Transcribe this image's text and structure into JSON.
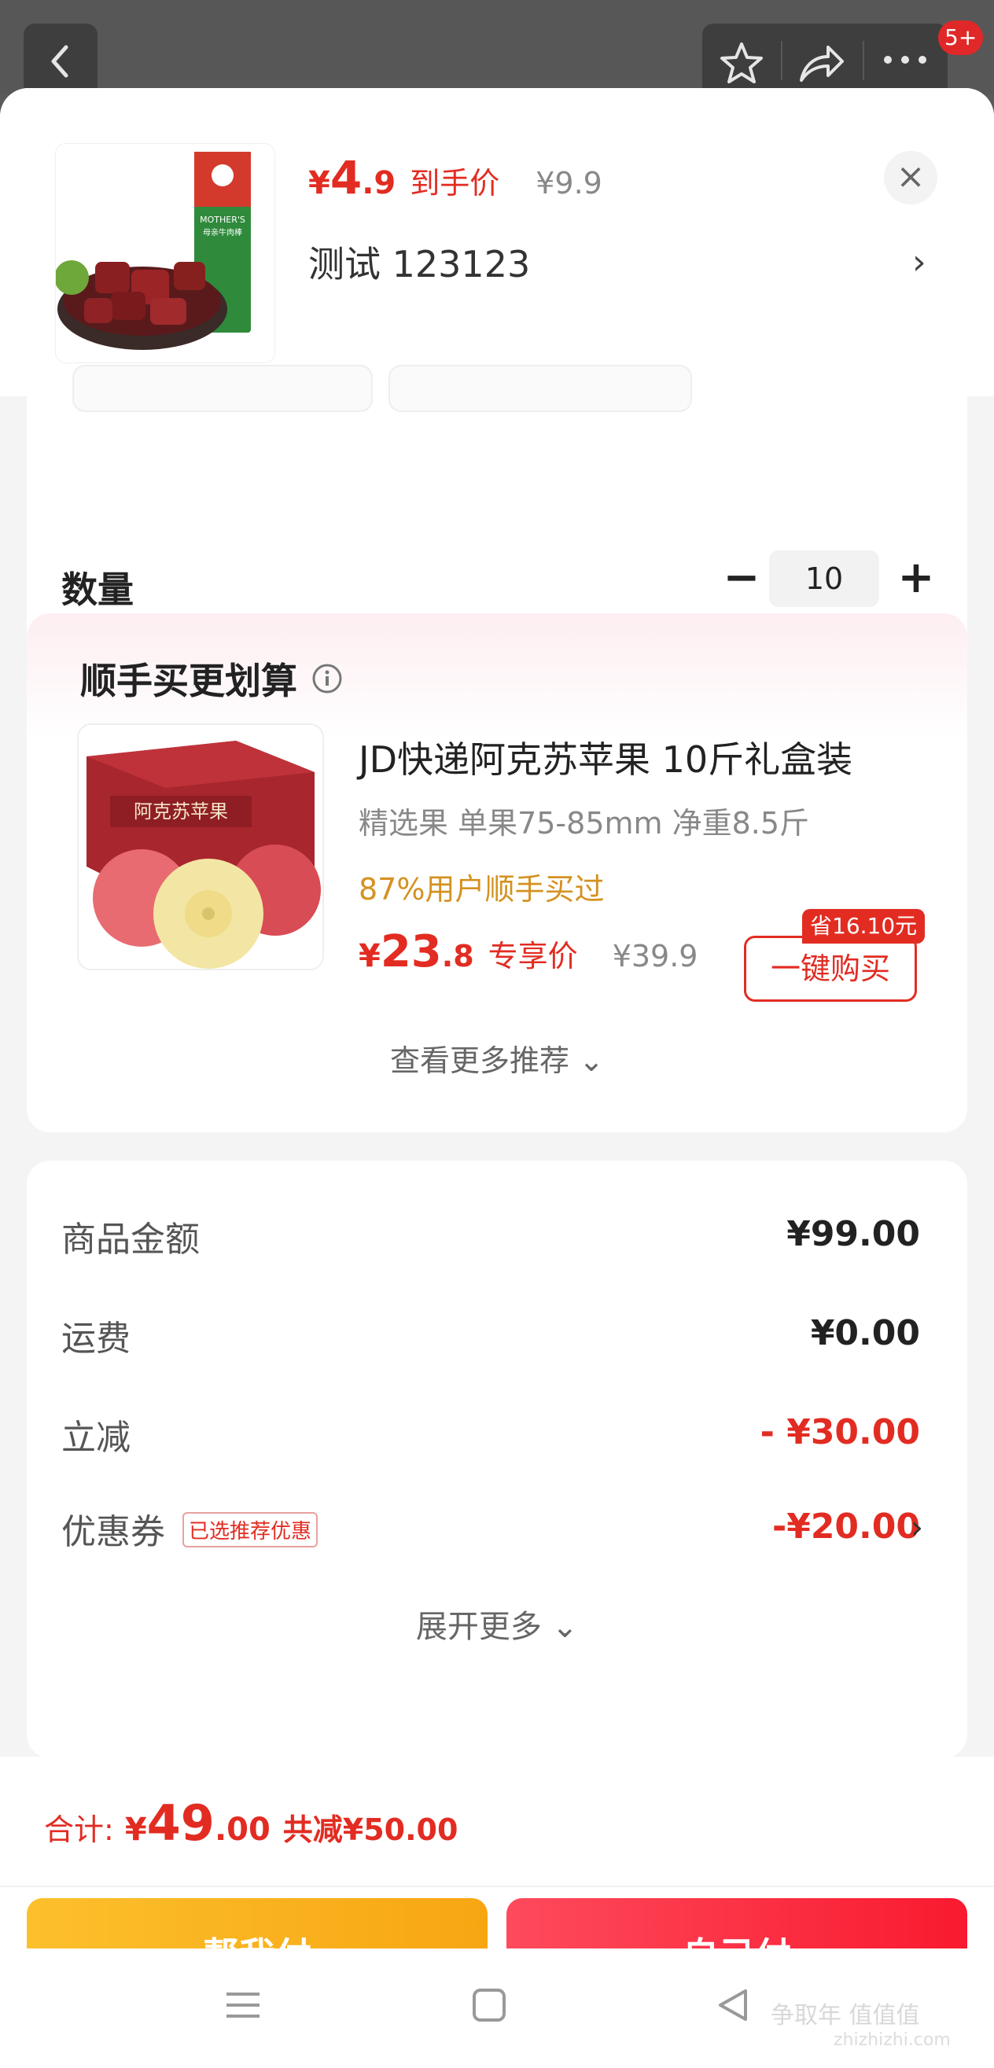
{
  "topbar": {
    "badge": "5+"
  },
  "product": {
    "currency": "¥",
    "price_int": "4",
    "price_dec": ".9",
    "price_tag": "到手价",
    "original_price": "¥9.9",
    "sku_name": "测试  123123",
    "arrow": "›",
    "close": "×",
    "image_label": "MOTHER'S 母亲牛肉棒"
  },
  "quantity": {
    "label": "数量",
    "value": "10",
    "minus": "−",
    "plus": "+"
  },
  "recommend": {
    "title": "顺手买更划算",
    "item": {
      "name": "JD快递阿克苏苹果 10斤礼盒装",
      "subtitle": "精选果 单果75-85mm 净重8.5斤",
      "popularity": "87%用户顺手买过",
      "currency": "¥",
      "price_int": "23",
      "price_dec": ".8",
      "price_tag": "专享价",
      "original_price": "¥39.9",
      "save_badge": "省16.10元",
      "buy_label": "一键购买",
      "image_label": "阿克苏苹果"
    },
    "more_label": "查看更多推荐 ⌄"
  },
  "summary": {
    "rows": [
      {
        "label": "商品金额",
        "value": "¥99.00"
      },
      {
        "label": "运费",
        "value": "¥0.00"
      },
      {
        "label": "立减",
        "value": "- ¥30.00"
      },
      {
        "label": "优惠券",
        "value": "-¥20.00"
      }
    ],
    "coupon_tag": "已选推荐优惠",
    "expand_label": "展开更多 ⌄"
  },
  "footer": {
    "total_label": "合计:",
    "currency": "¥",
    "total_int": "49",
    "total_dec": ".00",
    "saved": "共减¥50.00",
    "help_pay": "帮我付",
    "self_pay": "自己付"
  },
  "watermark": {
    "text": "争取年 值值值",
    "url": "zhizhizhi.com"
  },
  "colors": {
    "accent": "#e22c22",
    "help_btn": "#f7a612",
    "self_btn": "#f91a2f",
    "popularity": "#d49220"
  }
}
